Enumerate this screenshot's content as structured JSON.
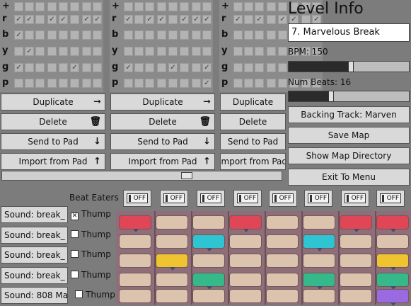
{
  "patterns": [
    {
      "rows": [
        {
          "label": "+",
          "checks": [
            0,
            0,
            0,
            0,
            0,
            0,
            0,
            0
          ]
        },
        {
          "label": "r",
          "checks": [
            1,
            1,
            0,
            1,
            1,
            0,
            1,
            1
          ]
        },
        {
          "label": "b",
          "checks": [
            1,
            0,
            0,
            0,
            0,
            0,
            0,
            0
          ]
        },
        {
          "label": "y",
          "checks": [
            0,
            1,
            0,
            0,
            0,
            0,
            0,
            0
          ]
        },
        {
          "label": "g",
          "checks": [
            1,
            0,
            0,
            0,
            0,
            1,
            0,
            0
          ]
        },
        {
          "label": "p",
          "checks": [
            0,
            0,
            0,
            0,
            0,
            0,
            0,
            0
          ]
        }
      ]
    },
    {
      "rows": [
        {
          "label": "+",
          "checks": [
            0,
            0,
            0,
            0,
            0,
            0,
            0,
            0
          ]
        },
        {
          "label": "r",
          "checks": [
            1,
            0,
            1,
            1,
            0,
            1,
            1,
            1
          ]
        },
        {
          "label": "b",
          "checks": [
            0,
            0,
            0,
            0,
            0,
            0,
            0,
            0
          ]
        },
        {
          "label": "y",
          "checks": [
            0,
            0,
            0,
            0,
            0,
            0,
            0,
            0
          ]
        },
        {
          "label": "g",
          "checks": [
            1,
            0,
            0,
            0,
            1,
            0,
            0,
            1
          ]
        },
        {
          "label": "p",
          "checks": [
            0,
            0,
            0,
            0,
            0,
            0,
            0,
            1
          ]
        }
      ]
    },
    {
      "rows": [
        {
          "label": "+",
          "checks": [
            0,
            0,
            0,
            0,
            0,
            0,
            0,
            0
          ]
        },
        {
          "label": "r",
          "checks": [
            1,
            0,
            1,
            0,
            1,
            1,
            0,
            1
          ]
        },
        {
          "label": "b",
          "checks": [
            0,
            0,
            0,
            0,
            0,
            0,
            0,
            0
          ]
        },
        {
          "label": "y",
          "checks": [
            0,
            0,
            0,
            0,
            0,
            0,
            0,
            0
          ]
        },
        {
          "label": "g",
          "checks": [
            0,
            0,
            0,
            0,
            0,
            0,
            0,
            0
          ]
        },
        {
          "label": "p",
          "checks": [
            0,
            0,
            0,
            0,
            0,
            0,
            0,
            0
          ]
        }
      ]
    }
  ],
  "pattern_buttons": {
    "duplicate": "Duplicate",
    "delete": "Delete",
    "send_to_pad": "Send to Pad",
    "import_from_pad": "Import from Pad",
    "icons": {
      "duplicate": "arrow-right-icon",
      "delete": "trash-icon",
      "send_to_pad": "arrow-down-icon",
      "import_from_pad": "arrow-up-icon"
    }
  },
  "level_info": {
    "title": "Level Info",
    "level_name": "7. Marvelous Break",
    "bpm_label": "BPM: 150",
    "bpm_value": 150,
    "num_beats_label": "Num Beats: 16",
    "num_beats_value": 16,
    "backing_track": "Backing Track: Marven",
    "save_map": "Save Map",
    "show_map_directory": "Show Map Directory",
    "exit_to_menu": "Exit To Menu"
  },
  "beat_eaters": {
    "label": "Beat Eaters",
    "toggles": [
      "OFF",
      "OFF",
      "OFF",
      "OFF",
      "OFF",
      "OFF",
      "OFF",
      "OFF"
    ]
  },
  "tracks": [
    {
      "sound": "Sound: break_",
      "thump": "Thump",
      "thump_checked": true
    },
    {
      "sound": "Sound: break_",
      "thump": "Thump",
      "thump_checked": false
    },
    {
      "sound": "Sound: break_",
      "thump": "Thump",
      "thump_checked": false
    },
    {
      "sound": "Sound: break_",
      "thump": "Thump",
      "thump_checked": false
    },
    {
      "sound": "Sound: 808 Ma",
      "thump": "Thump",
      "thump_checked": false
    }
  ],
  "sequencer": {
    "colors": {
      "empty": "#dcc3ad",
      "red": "#e04656",
      "cyan": "#2fc4d1",
      "yellow": "#f0c330",
      "green": "#36b98a",
      "purple": "#9a6be0"
    },
    "rows": [
      [
        "red",
        "empty",
        "empty",
        "red",
        "empty",
        "empty",
        "red",
        "red"
      ],
      [
        "empty",
        "empty",
        "cyan",
        "empty",
        "empty",
        "cyan",
        "empty",
        "empty"
      ],
      [
        "empty",
        "yellow",
        "empty",
        "empty",
        "empty",
        "empty",
        "empty",
        "yellow"
      ],
      [
        "empty",
        "empty",
        "green",
        "empty",
        "empty",
        "green",
        "empty",
        "green"
      ],
      [
        "empty",
        "empty",
        "empty",
        "empty",
        "empty",
        "empty",
        "empty",
        "purple"
      ]
    ]
  }
}
